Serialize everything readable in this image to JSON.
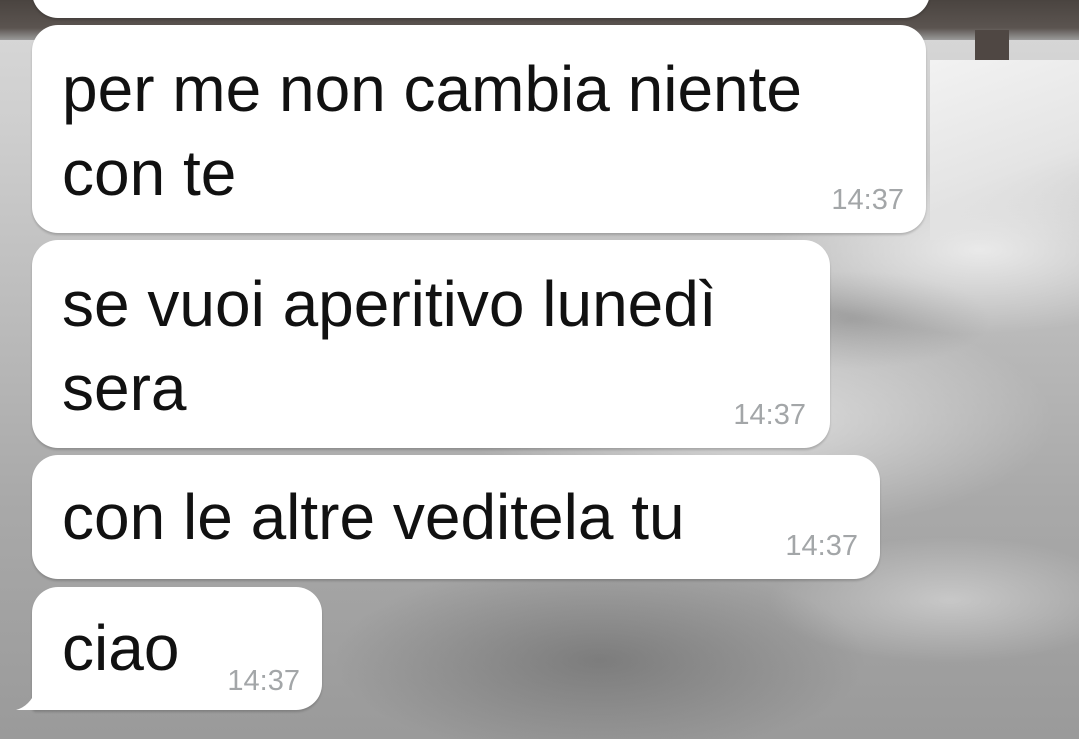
{
  "chat": {
    "messages": [
      {
        "text": "",
        "time": ""
      },
      {
        "line1": "per me non cambia niente",
        "line2": "con te",
        "time": "14:37"
      },
      {
        "line1": "se vuoi aperitivo lunedì",
        "line2": "sera",
        "time": "14:37"
      },
      {
        "text": "con le altre veditela tu",
        "time": "14:37"
      },
      {
        "text": "ciao",
        "time": "14:37"
      }
    ]
  },
  "colors": {
    "bubble": "#ffffff",
    "text": "#111111",
    "timestamp": "#a3a6a8"
  }
}
